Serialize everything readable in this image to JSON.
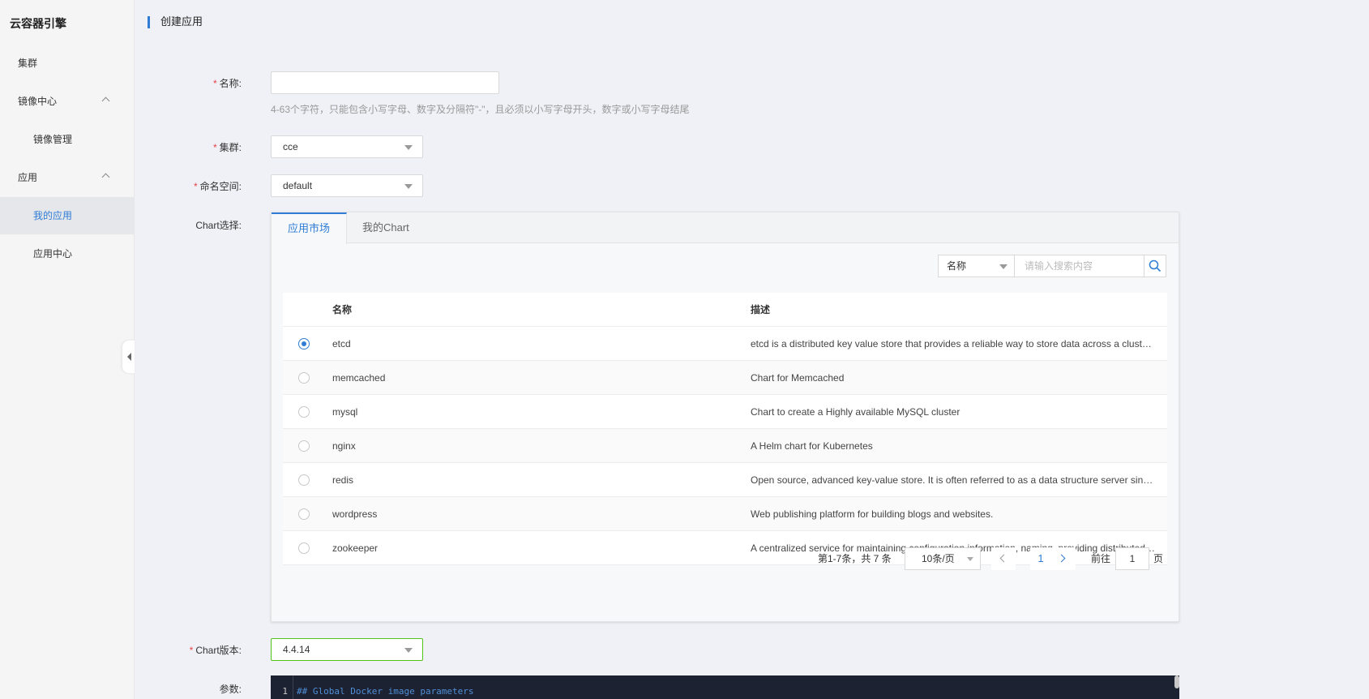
{
  "sidebar": {
    "brand": "云容器引擎",
    "items": [
      {
        "label": "集群"
      },
      {
        "label": "镜像中心"
      },
      {
        "label": "镜像管理"
      },
      {
        "label": "应用"
      },
      {
        "label": "我的应用"
      },
      {
        "label": "应用中心"
      }
    ]
  },
  "header": {
    "title": "创建应用"
  },
  "form": {
    "name": {
      "label": "名称:",
      "value": "",
      "hint": "4-63个字符，只能包含小写字母、数字及分隔符\"-\"，且必须以小写字母开头，数字或小写字母结尾"
    },
    "cluster": {
      "label": "集群:",
      "value": "cce"
    },
    "namespace": {
      "label": "命名空间:",
      "value": "default"
    },
    "chart_select": {
      "label": "Chart选择:"
    },
    "chart_version": {
      "label": "Chart版本:",
      "value": "4.4.14"
    },
    "params": {
      "label": "参数:"
    }
  },
  "chart_panel": {
    "tabs": [
      {
        "label": "应用市场"
      },
      {
        "label": "我的Chart"
      }
    ],
    "search": {
      "type": "名称",
      "placeholder": "请输入搜索内容"
    },
    "columns": {
      "name": "名称",
      "desc": "描述"
    },
    "rows": [
      {
        "name": "etcd",
        "desc": "etcd is a distributed key value store that provides a reliable way to store data across a cluster of machines",
        "selected": true
      },
      {
        "name": "memcached",
        "desc": "Chart for Memcached",
        "selected": false
      },
      {
        "name": "mysql",
        "desc": "Chart to create a Highly available MySQL cluster",
        "selected": false
      },
      {
        "name": "nginx",
        "desc": "A Helm chart for Kubernetes",
        "selected": false
      },
      {
        "name": "redis",
        "desc": "Open source, advanced key-value store. It is often referred to as a data structure server since keys can contain strings",
        "selected": false
      },
      {
        "name": "wordpress",
        "desc": "Web publishing platform for building blogs and websites.",
        "selected": false
      },
      {
        "name": "zookeeper",
        "desc": "A centralized service for maintaining configuration information, naming, providing distributed synchronization",
        "selected": false
      }
    ],
    "pagination": {
      "summary": "第1-7条，共 7 条",
      "page_size": "10条/页",
      "current_page": "1",
      "goto_label": "前往",
      "goto_value": "1",
      "goto_suffix": "页"
    }
  },
  "editor": {
    "line_number": "1",
    "first_line": "## Global Docker image parameters"
  },
  "colors": {
    "accent": "#2f7cd4",
    "required": "#e54545",
    "editor_bg": "#1d2233"
  }
}
